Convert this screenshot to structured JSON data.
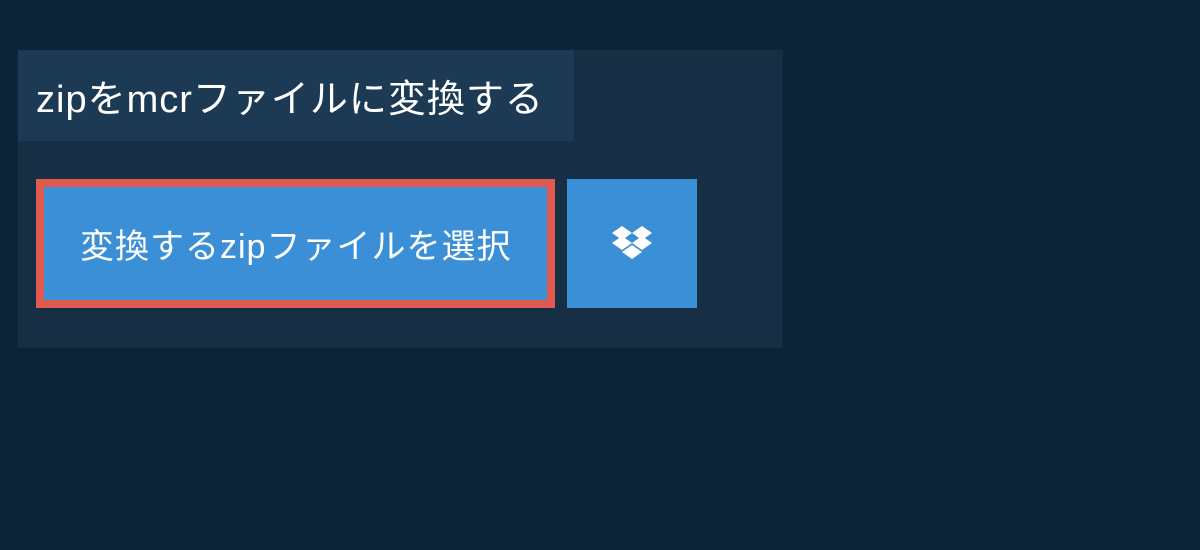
{
  "header": {
    "title": "zipをmcrファイルに変換する"
  },
  "actions": {
    "select_file_label": "変換するzipファイルを選択",
    "dropbox_icon": "dropbox-icon"
  }
}
